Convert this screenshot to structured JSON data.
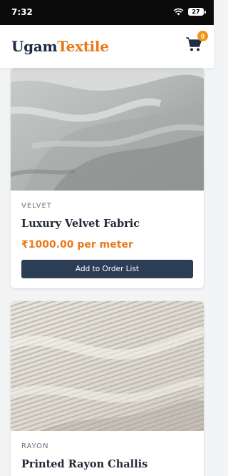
{
  "status_bar": {
    "time": "7:32",
    "battery": "27"
  },
  "header": {
    "brand_part1": "Ugam",
    "brand_part2": "Textile",
    "cart_count": "0",
    "colors": {
      "navy": "#1f2a44",
      "orange": "#e87a1d"
    }
  },
  "products": [
    {
      "category": "VELVET",
      "title": "Luxury Velvet Fabric",
      "price": "₹1000.00 per meter",
      "button": "Add to Order List",
      "image": "grey-velvet-fabric-photo"
    },
    {
      "category": "RAYON",
      "title": "Printed Rayon Challis",
      "image": "white-corduroy-fabric-photo"
    }
  ]
}
